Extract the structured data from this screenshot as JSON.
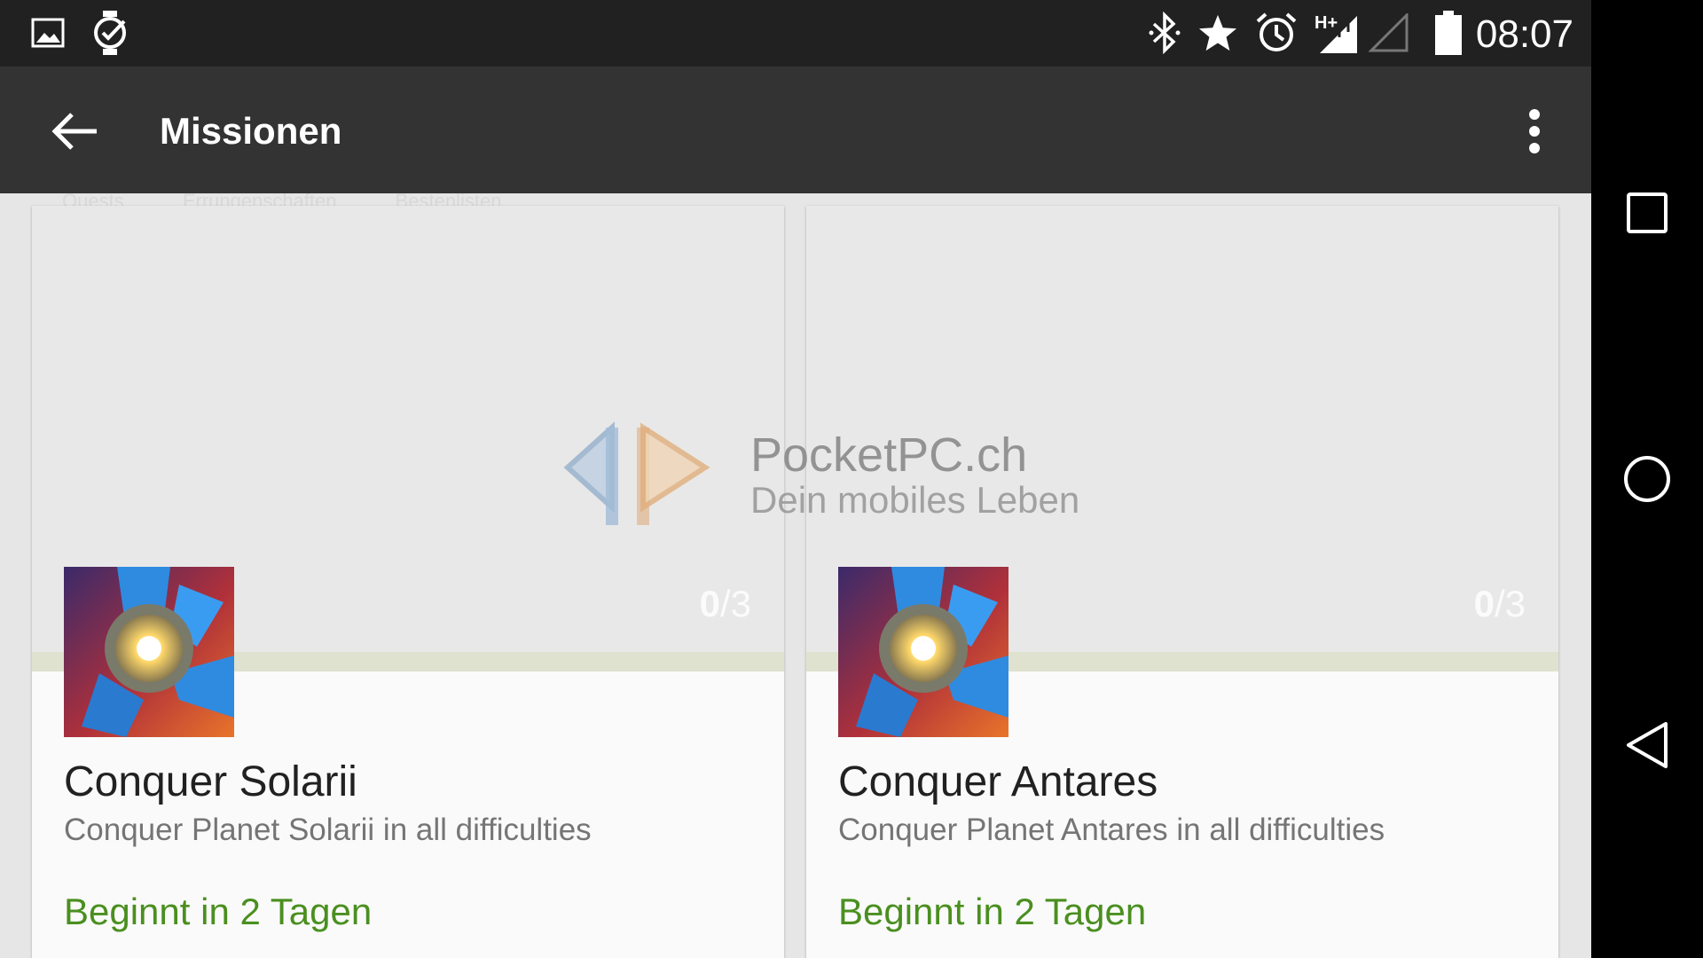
{
  "status_bar": {
    "time": "08:07",
    "network_label": "H+",
    "icons": [
      "gallery-icon",
      "watch-check-icon",
      "bluetooth-icon",
      "star-icon",
      "alarm-icon",
      "signal-hplus-icon",
      "signal-empty-icon",
      "battery-icon"
    ]
  },
  "app_bar": {
    "title": "Missionen",
    "back_icon": "arrow-left-icon",
    "overflow_icon": "more-vert-icon"
  },
  "tabs_ghost": [
    "Quests",
    "Errungenschaften",
    "Bestenlisten"
  ],
  "missions": [
    {
      "title": "Conquer Solarii",
      "description": "Conquer Planet Solarii in all difficulties",
      "status": "Beginnt in 2 Tagen",
      "progress_done": "0",
      "progress_total": "/3",
      "progress_fraction": 0
    },
    {
      "title": "Conquer Antares",
      "description": "Conquer Planet Antares in all difficulties",
      "status": "Beginnt in 2 Tagen",
      "progress_done": "0",
      "progress_total": "/3",
      "progress_fraction": 0
    }
  ],
  "watermark": {
    "brand": "PocketPC.ch",
    "tagline": "Dein mobiles Leben"
  },
  "nav_bar": {
    "icons": [
      "recents-icon",
      "home-icon",
      "back-icon"
    ]
  },
  "colors": {
    "app_bar": "#333333",
    "status_bar": "#212121",
    "status_green": "#4a8f1f",
    "progress_track": "#dfe2cf"
  }
}
